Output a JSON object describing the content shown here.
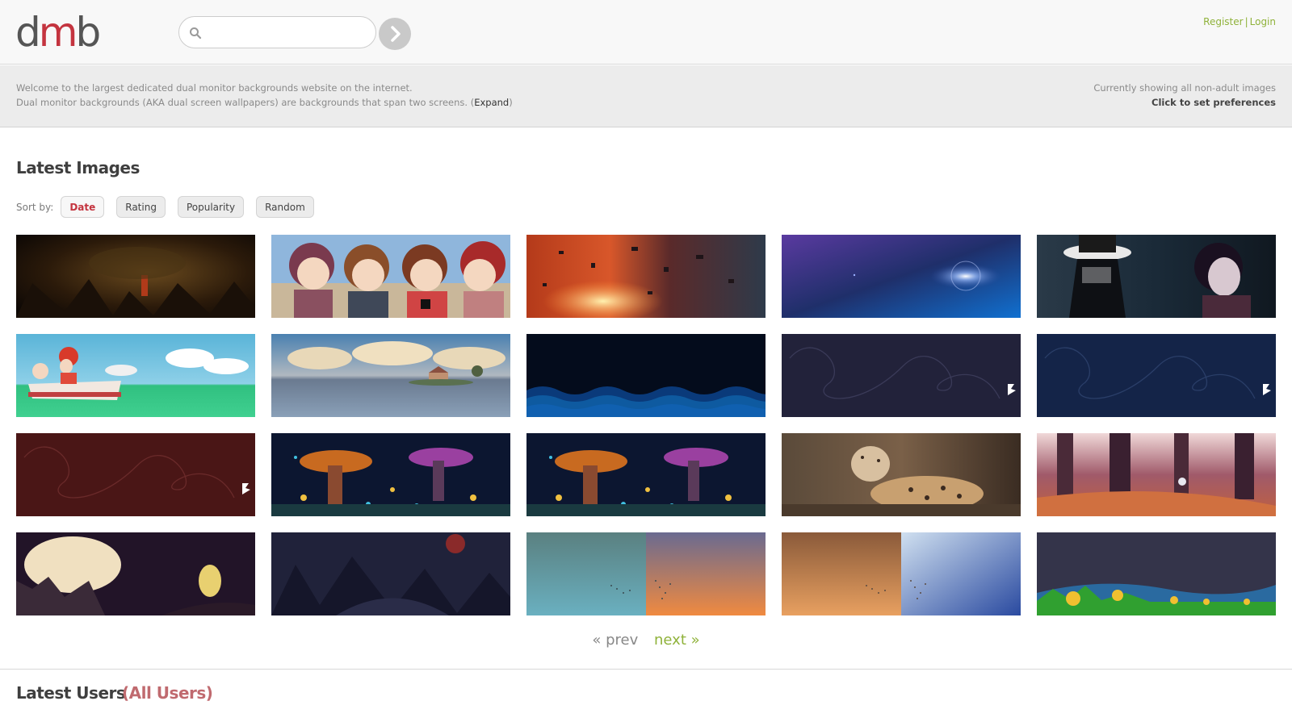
{
  "header": {
    "logo_d": "d",
    "logo_m": "m",
    "logo_b": "b",
    "search": {
      "placeholder": "",
      "value": ""
    },
    "register_label": "Register",
    "separator": "|",
    "login_label": "Login"
  },
  "welcome": {
    "line1": "Welcome to the largest dedicated dual monitor backgrounds website on the internet.",
    "line2_prefix": "Dual monitor backgrounds (AKA dual screen wallpapers) are backgrounds that span two screens. (",
    "expand_label": "Expand",
    "line2_suffix": ")",
    "status": "Currently showing all non-adult images",
    "prefs_label": "Click to set preferences"
  },
  "latest_images": {
    "title": "Latest Images",
    "sort_label": "Sort by:",
    "sort_options": [
      "Date",
      "Rating",
      "Popularity",
      "Random"
    ],
    "active_sort": "Date"
  },
  "thumbnails": [
    {
      "subject": "dragon-cave"
    },
    {
      "subject": "anime-girls"
    },
    {
      "subject": "red-space-debris"
    },
    {
      "subject": "blue-space-glow"
    },
    {
      "subject": "anime-hat-characters"
    },
    {
      "subject": "anime-boat"
    },
    {
      "subject": "lake-island-clouds"
    },
    {
      "subject": "dark-waves"
    },
    {
      "subject": "swirl-dark-navy"
    },
    {
      "subject": "swirl-blue"
    },
    {
      "subject": "swirl-maroon"
    },
    {
      "subject": "fantasy-mushroom-forest"
    },
    {
      "subject": "fantasy-mushroom-forest"
    },
    {
      "subject": "snow-leopard"
    },
    {
      "subject": "pink-forest"
    },
    {
      "subject": "egg-cave"
    },
    {
      "subject": "dark-fantasy-moon"
    },
    {
      "subject": "teal-orange-gradient-birds"
    },
    {
      "subject": "orange-blue-gradient-birds"
    },
    {
      "subject": "pixel-landscape"
    }
  ],
  "pager": {
    "prev_label": "« prev",
    "next_label": "next »"
  },
  "latest_users": {
    "title": "Latest Users",
    "all_label": "(All Users)"
  },
  "colors": {
    "accent_red": "#c4343f",
    "link_green": "#8fb23a",
    "text_gray": "#8a8a8a"
  }
}
